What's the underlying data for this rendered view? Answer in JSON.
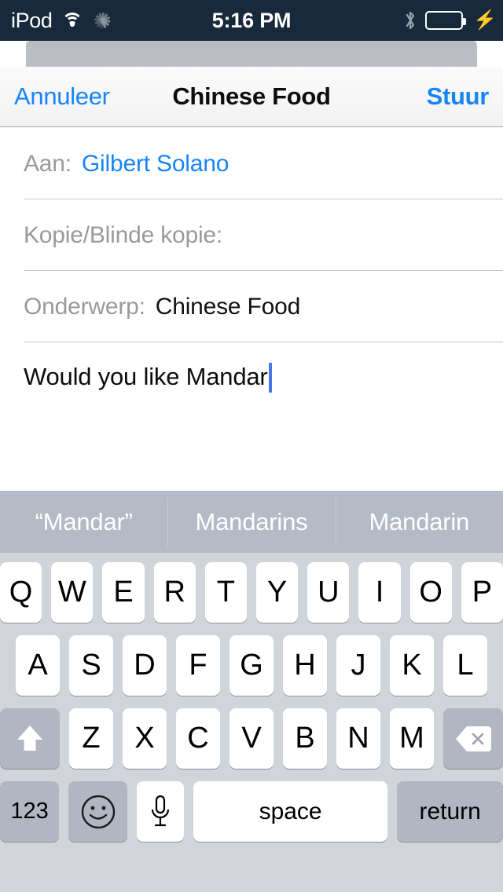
{
  "statusbar": {
    "carrier": "iPod",
    "time": "5:16 PM",
    "wifi_icon": "wifi-icon",
    "activity_icon": "activity-spinner-icon",
    "bluetooth_icon": "bluetooth-icon",
    "battery_icon": "battery-full-icon",
    "charging_icon": "charging-bolt-icon",
    "battery_color": "#2fd855",
    "background_color": "#17293a"
  },
  "navbar": {
    "cancel_label": "Annuleer",
    "title": "Chinese Food",
    "send_label": "Stuur",
    "accent_color": "#1785f7"
  },
  "compose": {
    "to_label": "Aan:",
    "to_value": "Gilbert Solano",
    "cc_label": "Kopie/Blinde kopie:",
    "cc_value": "",
    "subject_label": "Onderwerp:",
    "subject_value": "Chinese Food",
    "body_value": "Would you like Mandar",
    "caret_color": "#4a77e8"
  },
  "suggestions": [
    {
      "label": "“Mandar”"
    },
    {
      "label": "Mandarins"
    },
    {
      "label": "Mandarin"
    }
  ],
  "keyboard": {
    "row1": [
      "Q",
      "W",
      "E",
      "R",
      "T",
      "Y",
      "U",
      "I",
      "O",
      "P"
    ],
    "row2": [
      "A",
      "S",
      "D",
      "F",
      "G",
      "H",
      "J",
      "K",
      "L"
    ],
    "row3": [
      "Z",
      "X",
      "C",
      "V",
      "B",
      "N",
      "M"
    ],
    "shift_icon": "shift-arrow-icon",
    "delete_icon": "backspace-delete-icon",
    "numeric_label": "123",
    "emoji_icon": "emoji-smiley-icon",
    "dictation_icon": "microphone-icon",
    "space_label": "space",
    "return_label": "return",
    "background_color": "#d1d5da",
    "key_color": "#ffffff",
    "modifier_key_color": "#b0b6c2"
  }
}
